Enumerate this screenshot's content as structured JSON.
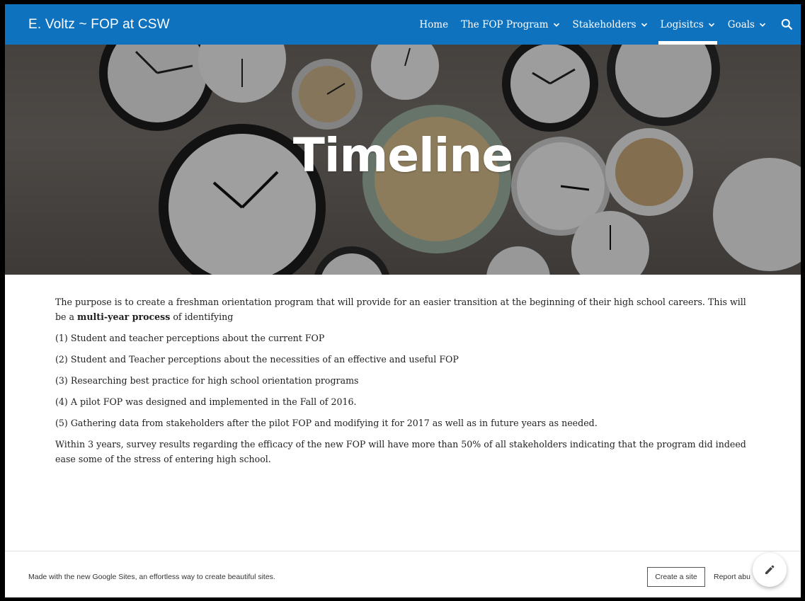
{
  "site": {
    "title": "E. Voltz ~ FOP at CSW"
  },
  "nav": {
    "items": [
      {
        "label": "Home",
        "dropdown": false,
        "active": false
      },
      {
        "label": "The FOP Program",
        "dropdown": true,
        "active": false
      },
      {
        "label": "Stakeholders",
        "dropdown": true,
        "active": false
      },
      {
        "label": "Logisitcs",
        "dropdown": true,
        "active": true
      },
      {
        "label": "Goals",
        "dropdown": true,
        "active": false
      }
    ],
    "search_icon": "search-icon"
  },
  "hero": {
    "title": "Timeline",
    "background": "wall-of-clocks"
  },
  "content": {
    "intro_before": "The purpose is to create a freshman orientation program that will provide for an easier transition at the beginning of their high school careers. This will be a ",
    "intro_bold": "multi-year process",
    "intro_after": " of identifying",
    "items": [
      "(1) Student and teacher perceptions about the current FOP",
      "(2) Student and Teacher perceptions about the necessities of an effective and useful FOP",
      "(3) Researching best practice for high school orientation programs",
      "(4) A pilot FOP was designed and implemented in the Fall of 2016.",
      "(5) Gathering data from stakeholders after the pilot FOP and modifying it for 2017 as well as in future years as needed."
    ],
    "conclusion": "Within 3 years, survey results regarding the efficacy of the new FOP will have more than 50% of all stakeholders indicating that the program did indeed ease some of the stress of entering high school."
  },
  "footer": {
    "made_with": "Made with the new Google Sites, an effortless way to create beautiful sites.",
    "create_site": "Create a site",
    "report_abuse": "Report abu"
  },
  "colors": {
    "nav_bg": "#0f72bf",
    "text": "#212121"
  }
}
